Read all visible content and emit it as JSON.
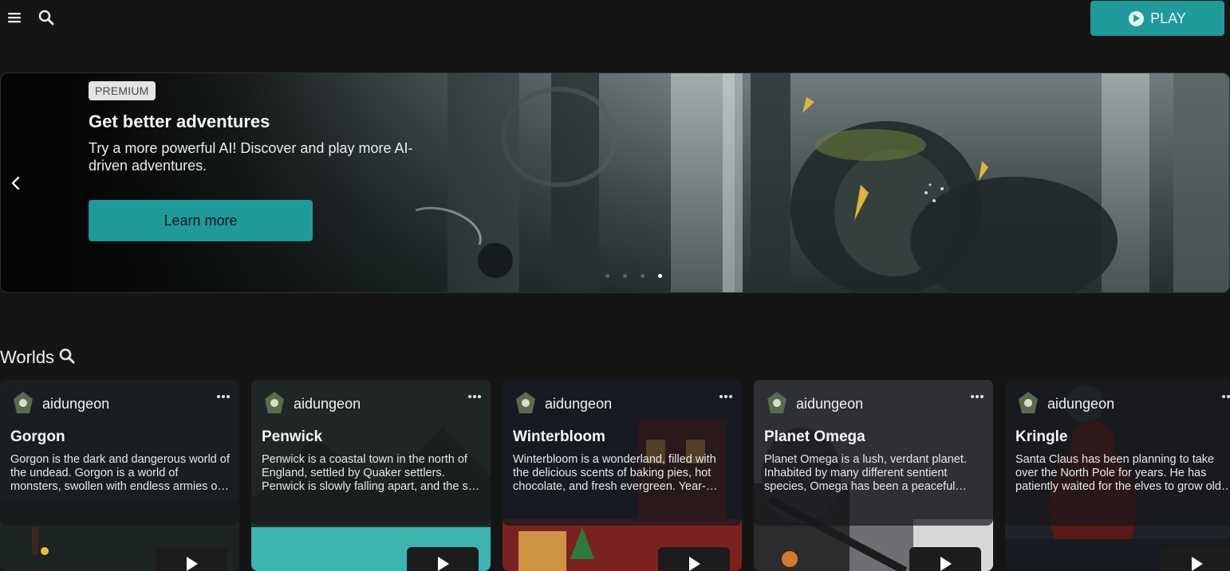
{
  "topbar": {
    "menu_icon": "hamburger-menu-icon",
    "search_icon": "search-icon",
    "play_label": "PLAY",
    "play_icon": "play-circle-icon",
    "accent": "#1e9a9b"
  },
  "banner": {
    "badge": "PREMIUM",
    "title": "Get better adventures",
    "description": "Try a more powerful AI! Discover and play more AI-driven adventures.",
    "cta_label": "Learn more",
    "prev_icon": "chevron-left-icon",
    "slide_count": 4,
    "active_slide": 4
  },
  "worlds": {
    "heading": "Worlds",
    "heading_icon": "search-icon",
    "cards": [
      {
        "author": "aidungeon",
        "title": "Gorgon",
        "description": "Gorgon is the dark and dangerous world of the undead. Gorgon is a world of monsters, swollen with endless armies of the undead and dark magic."
      },
      {
        "author": "aidungeon",
        "title": "Penwick",
        "description": "Penwick is a coastal town in the north of England, settled by Quaker settlers. Penwick is slowly falling apart, and the sea is creeping ever closer."
      },
      {
        "author": "aidungeon",
        "title": "Winterbloom",
        "description": "Winterbloom is a wonderland, filled with the delicious scents of baking pies, hot chocolate, and fresh evergreen. Year-round festivities fill the streets."
      },
      {
        "author": "aidungeon",
        "title": "Planet Omega",
        "description": "Planet Omega is a lush, verdant planet. Inhabited by many different sentient species, Omega has been a peaceful world for centuries."
      },
      {
        "author": "aidungeon",
        "title": "Kringle",
        "description": "Santa Claus has been planning to take over the North Pole for years. He has patiently waited for the elves to grow old and weak."
      }
    ]
  }
}
